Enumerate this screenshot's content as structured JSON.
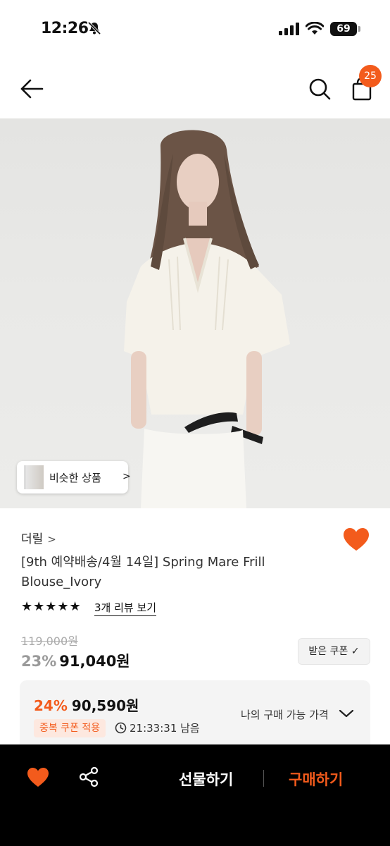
{
  "status_bar": {
    "time": "12:26",
    "battery": "69"
  },
  "header": {
    "cart_count": "25"
  },
  "hero": {
    "similar_label": "비슷한 상품",
    "similar_chevron": ">"
  },
  "product": {
    "brand": "더릴",
    "brand_chevron": ">",
    "title": "[9th 예약배송/4월 14일] Spring Mare Frill Blouse_Ivory",
    "rating_stars": "★★★★★",
    "rating": 5,
    "review_link": "3개 리뷰 보기",
    "original_price": "119,000원",
    "discount_percent": "23%",
    "sale_price": "91,040원",
    "coupon_button": "받은 쿠폰 ✓"
  },
  "coupon_box": {
    "best_percent": "24%",
    "best_price": "90,590원",
    "dup_badge": "중복 쿠폰 적용",
    "timer": "21:33:31 남음",
    "my_price_label": "나의 구매 가능 가격"
  },
  "bottom_bar": {
    "gift_label": "선물하기",
    "buy_label": "구매하기"
  },
  "colors": {
    "accent": "#f35b1c",
    "text": "#111111",
    "bar_bg": "#000000"
  }
}
